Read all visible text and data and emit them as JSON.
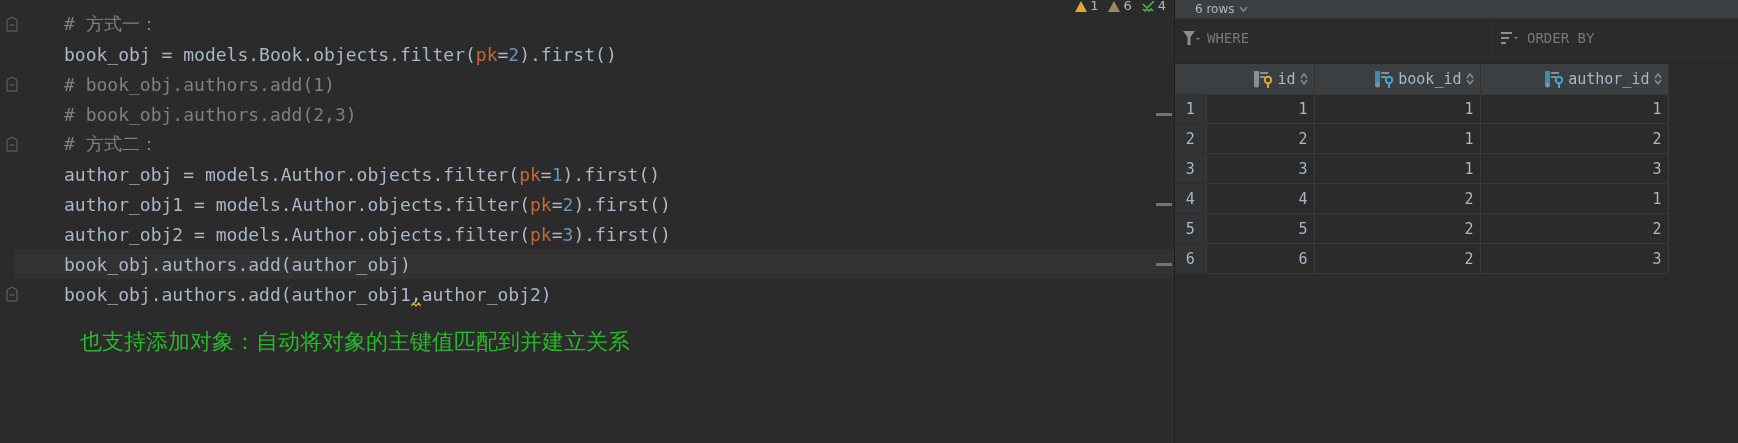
{
  "editor": {
    "inspections": [
      {
        "kind": "error",
        "count": "1"
      },
      {
        "kind": "warning",
        "count": "6"
      },
      {
        "kind": "typo",
        "count": "4"
      }
    ],
    "lines": [
      {
        "fold": true,
        "current": false,
        "stripe_mark": false,
        "tokens": [
          {
            "kind": "comment",
            "text": "# 方式一："
          }
        ]
      },
      {
        "fold": false,
        "current": false,
        "stripe_mark": false,
        "tokens": [
          {
            "kind": "code",
            "text": "book_obj = models.Book.objects.filter("
          },
          {
            "kind": "param",
            "text": "pk"
          },
          {
            "kind": "code",
            "text": "="
          },
          {
            "kind": "number",
            "text": "2"
          },
          {
            "kind": "code",
            "text": ").first()"
          }
        ]
      },
      {
        "fold": true,
        "current": false,
        "stripe_mark": false,
        "tokens": [
          {
            "kind": "comment",
            "text": "# book_obj.authors.add(1)"
          }
        ]
      },
      {
        "fold": false,
        "current": false,
        "stripe_mark": true,
        "tokens": [
          {
            "kind": "comment",
            "text": "# book_obj.authors.add(2,3)"
          }
        ]
      },
      {
        "fold": true,
        "current": false,
        "stripe_mark": false,
        "tokens": [
          {
            "kind": "comment",
            "text": "# 方式二："
          }
        ]
      },
      {
        "fold": false,
        "current": false,
        "stripe_mark": false,
        "tokens": [
          {
            "kind": "code",
            "text": "author_obj = models.Author.objects.filter("
          },
          {
            "kind": "param",
            "text": "pk"
          },
          {
            "kind": "code",
            "text": "="
          },
          {
            "kind": "number",
            "text": "1"
          },
          {
            "kind": "code",
            "text": ").first()"
          }
        ]
      },
      {
        "fold": false,
        "current": false,
        "stripe_mark": true,
        "tokens": [
          {
            "kind": "code",
            "text": "author_obj1 = models.Author.objects.filter("
          },
          {
            "kind": "param",
            "text": "pk"
          },
          {
            "kind": "code",
            "text": "="
          },
          {
            "kind": "number",
            "text": "2"
          },
          {
            "kind": "code",
            "text": ").first()"
          }
        ]
      },
      {
        "fold": false,
        "current": false,
        "stripe_mark": false,
        "tokens": [
          {
            "kind": "code",
            "text": "author_obj2 = models.Author.objects.filter("
          },
          {
            "kind": "param",
            "text": "pk"
          },
          {
            "kind": "code",
            "text": "="
          },
          {
            "kind": "number",
            "text": "3"
          },
          {
            "kind": "code",
            "text": ").first()"
          }
        ]
      },
      {
        "fold": false,
        "current": true,
        "stripe_mark": true,
        "tokens": [
          {
            "kind": "code",
            "text": "book_obj.authors.add(author_obj)"
          }
        ]
      },
      {
        "fold": true,
        "current": false,
        "stripe_mark": false,
        "tokens": [
          {
            "kind": "code",
            "text": "book_obj.authors.add(author_obj1"
          },
          {
            "kind": "warned",
            "text": ","
          },
          {
            "kind": "code",
            "text": "author_obj2)"
          }
        ]
      }
    ],
    "note": "也支持添加对象：自动将对象的主键值匹配到并建立关系"
  },
  "results": {
    "row_count": "6 rows",
    "where_placeholder": "WHERE",
    "order_placeholder": "ORDER BY",
    "columns": [
      {
        "name": "id",
        "kind": "primary"
      },
      {
        "name": "book_id",
        "kind": "foreign"
      },
      {
        "name": "author_id",
        "kind": "foreign"
      }
    ],
    "rows": [
      {
        "number": "1",
        "cells": [
          "1",
          "1",
          "1"
        ]
      },
      {
        "number": "2",
        "cells": [
          "2",
          "1",
          "2"
        ]
      },
      {
        "number": "3",
        "cells": [
          "3",
          "1",
          "3"
        ]
      },
      {
        "number": "4",
        "cells": [
          "4",
          "2",
          "1"
        ]
      },
      {
        "number": "5",
        "cells": [
          "5",
          "2",
          "2"
        ]
      },
      {
        "number": "6",
        "cells": [
          "6",
          "2",
          "3"
        ]
      }
    ]
  }
}
